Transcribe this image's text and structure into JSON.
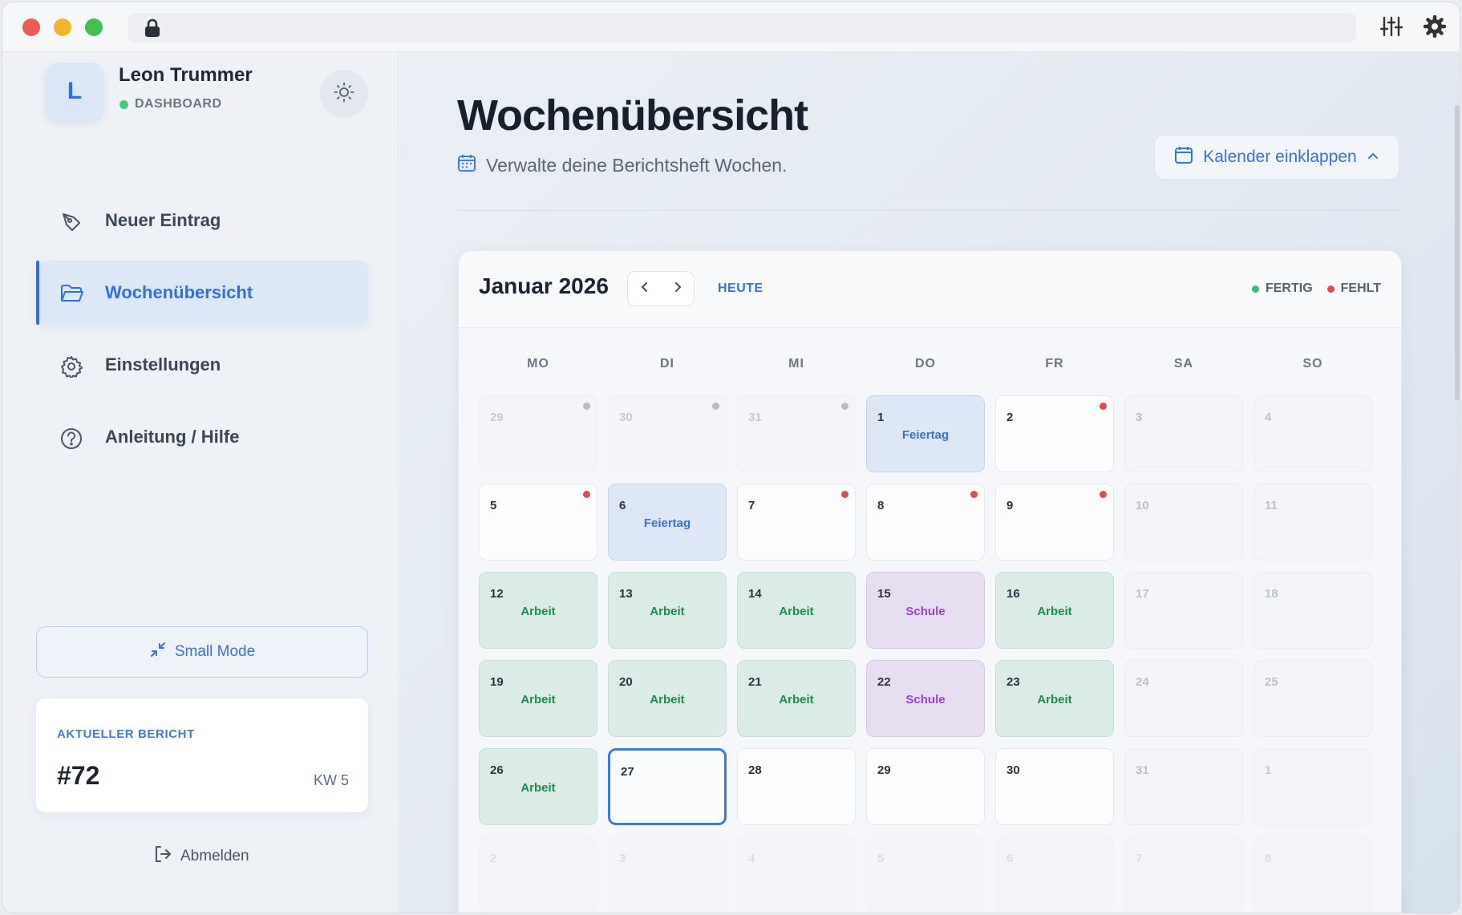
{
  "user": {
    "initial": "L",
    "name": "Leon Trummer",
    "role": "DASHBOARD"
  },
  "nav": [
    {
      "label": "Neuer Eintrag",
      "icon": "pen-icon",
      "active": false
    },
    {
      "label": "Wochenübersicht",
      "icon": "folder-open-icon",
      "active": true
    },
    {
      "label": "Einstellungen",
      "icon": "gear-icon",
      "active": false
    },
    {
      "label": "Anleitung / Hilfe",
      "icon": "help-circle-icon",
      "active": false
    }
  ],
  "small_mode_label": "Small Mode",
  "report": {
    "eyebrow": "AKTUELLER BERICHT",
    "number": "#72",
    "week": "KW 5"
  },
  "logout_label": "Abmelden",
  "page": {
    "title": "Wochenübersicht",
    "subtitle": "Verwalte deine Berichtsheft Wochen.",
    "collapse_label": "Kalender einklappen"
  },
  "calendar": {
    "month": "Januar 2026",
    "today_label": "HEUTE",
    "legend": [
      {
        "label": "FERTIG",
        "color": "#2fbf71"
      },
      {
        "label": "FEHLT",
        "color": "#e5484d"
      }
    ],
    "weekdays": [
      "MO",
      "DI",
      "MI",
      "DO",
      "FR",
      "SA",
      "SO"
    ],
    "weeks": [
      [
        {
          "day": "29",
          "state": "muted",
          "dot": "gray"
        },
        {
          "day": "30",
          "state": "muted",
          "dot": "gray"
        },
        {
          "day": "31",
          "state": "muted",
          "dot": "gray"
        },
        {
          "day": "1",
          "state": "feiertag",
          "tag": "Feiertag"
        },
        {
          "day": "2",
          "state": "blank",
          "dot": "red"
        },
        {
          "day": "3",
          "state": "weekend"
        },
        {
          "day": "4",
          "state": "weekend"
        }
      ],
      [
        {
          "day": "5",
          "state": "blank",
          "dot": "red"
        },
        {
          "day": "6",
          "state": "feiertag",
          "tag": "Feiertag"
        },
        {
          "day": "7",
          "state": "blank",
          "dot": "red"
        },
        {
          "day": "8",
          "state": "blank",
          "dot": "red"
        },
        {
          "day": "9",
          "state": "blank",
          "dot": "red"
        },
        {
          "day": "10",
          "state": "weekend"
        },
        {
          "day": "11",
          "state": "weekend"
        }
      ],
      [
        {
          "day": "12",
          "state": "arbeit",
          "tag": "Arbeit"
        },
        {
          "day": "13",
          "state": "arbeit",
          "tag": "Arbeit"
        },
        {
          "day": "14",
          "state": "arbeit",
          "tag": "Arbeit"
        },
        {
          "day": "15",
          "state": "schule",
          "tag": "Schule"
        },
        {
          "day": "16",
          "state": "arbeit",
          "tag": "Arbeit"
        },
        {
          "day": "17",
          "state": "weekend"
        },
        {
          "day": "18",
          "state": "weekend"
        }
      ],
      [
        {
          "day": "19",
          "state": "arbeit",
          "tag": "Arbeit"
        },
        {
          "day": "20",
          "state": "arbeit",
          "tag": "Arbeit"
        },
        {
          "day": "21",
          "state": "arbeit",
          "tag": "Arbeit"
        },
        {
          "day": "22",
          "state": "schule",
          "tag": "Schule"
        },
        {
          "day": "23",
          "state": "arbeit",
          "tag": "Arbeit"
        },
        {
          "day": "24",
          "state": "weekend"
        },
        {
          "day": "25",
          "state": "weekend"
        }
      ],
      [
        {
          "day": "26",
          "state": "arbeit",
          "tag": "Arbeit"
        },
        {
          "day": "27",
          "state": "today"
        },
        {
          "day": "28",
          "state": "blank"
        },
        {
          "day": "29",
          "state": "blank"
        },
        {
          "day": "30",
          "state": "blank"
        },
        {
          "day": "31",
          "state": "weekend"
        },
        {
          "day": "1",
          "state": "muted"
        }
      ],
      [
        {
          "day": "2",
          "state": "muted"
        },
        {
          "day": "3",
          "state": "muted"
        },
        {
          "day": "4",
          "state": "muted"
        },
        {
          "day": "5",
          "state": "muted"
        },
        {
          "day": "6",
          "state": "muted"
        },
        {
          "day": "7",
          "state": "muted"
        },
        {
          "day": "8",
          "state": "muted"
        }
      ]
    ]
  },
  "colors": {
    "accent": "#2f6fe0",
    "arbeit": "#1f8a58",
    "schule": "#9a3fd6",
    "dot_red": "#e5484d",
    "dot_gray": "#b8bec7"
  }
}
